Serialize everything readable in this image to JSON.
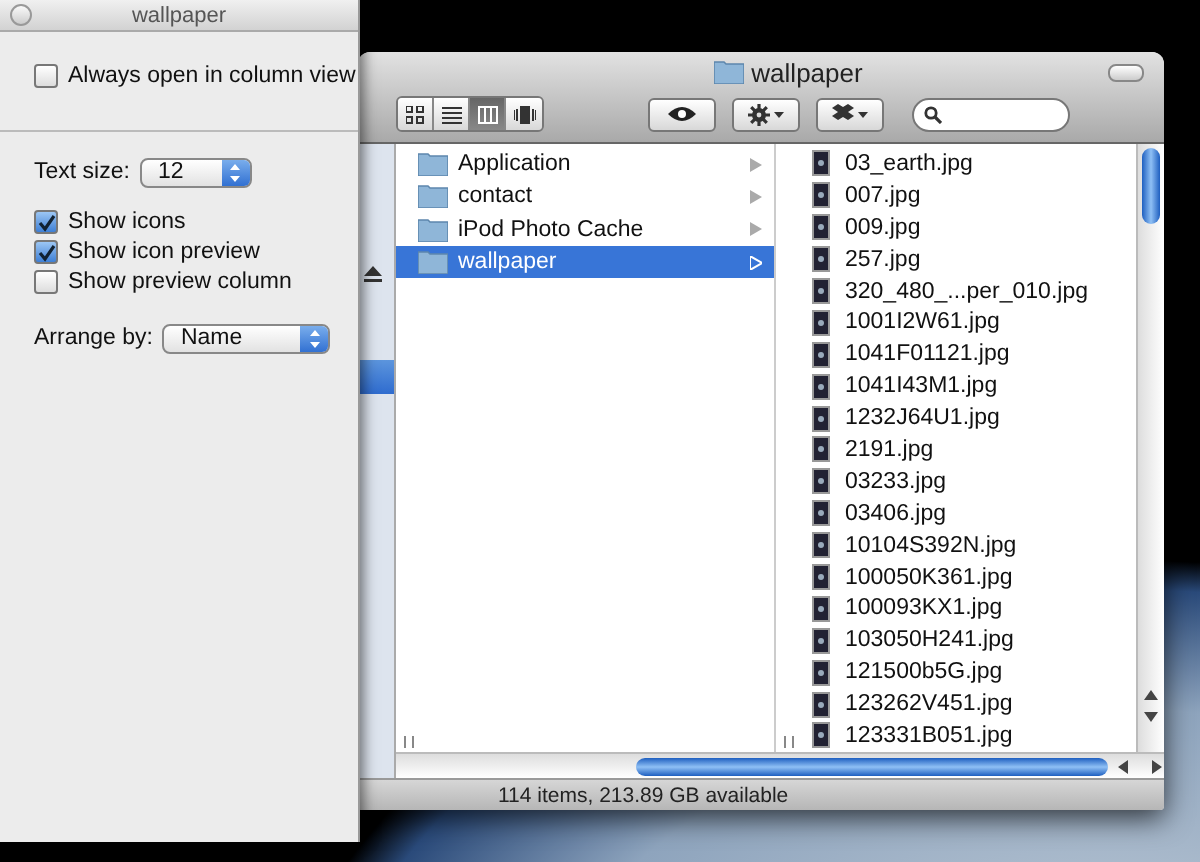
{
  "inspector": {
    "title": "wallpaper",
    "always_open": {
      "label": "Always open in column view",
      "checked": false
    },
    "text_size": {
      "label": "Text size:",
      "value": "12"
    },
    "options": [
      {
        "label": "Show icons",
        "checked": true
      },
      {
        "label": "Show icon preview",
        "checked": true
      },
      {
        "label": "Show preview column",
        "checked": false
      }
    ],
    "arrange_by": {
      "label": "Arrange by:",
      "value": "Name"
    }
  },
  "finder": {
    "title": "wallpaper",
    "view_modes": [
      {
        "kind": "icon",
        "selected": false
      },
      {
        "kind": "list",
        "selected": false
      },
      {
        "kind": "column",
        "selected": true
      },
      {
        "kind": "coverflow",
        "selected": false
      }
    ],
    "sidebar": [
      {
        "kind": "eject",
        "selected": false
      },
      {
        "kind": "blank",
        "selected": true
      }
    ],
    "folders": [
      {
        "name": "Application",
        "selected": false
      },
      {
        "name": "contact",
        "selected": false
      },
      {
        "name": "iPod Photo Cache",
        "selected": false
      },
      {
        "name": "wallpaper",
        "selected": true
      }
    ],
    "files": [
      {
        "name": "03_earth.jpg"
      },
      {
        "name": "007.jpg"
      },
      {
        "name": "009.jpg"
      },
      {
        "name": "257.jpg"
      },
      {
        "name": "320_480_...per_010.jpg"
      },
      {
        "name": "1001I2W61.jpg"
      },
      {
        "name": "1041F01121.jpg"
      },
      {
        "name": "1041I43M1.jpg"
      },
      {
        "name": "1232J64U1.jpg"
      },
      {
        "name": "2191.jpg"
      },
      {
        "name": "03233.jpg"
      },
      {
        "name": "03406.jpg"
      },
      {
        "name": "10104S392N.jpg"
      },
      {
        "name": "100050K361.jpg"
      },
      {
        "name": "100093KX1.jpg"
      },
      {
        "name": "103050H241.jpg"
      },
      {
        "name": "121500b5G.jpg"
      },
      {
        "name": "123262V451.jpg"
      },
      {
        "name": "123331B051.jpg"
      }
    ],
    "status": "114 items, 213.89 GB available"
  }
}
